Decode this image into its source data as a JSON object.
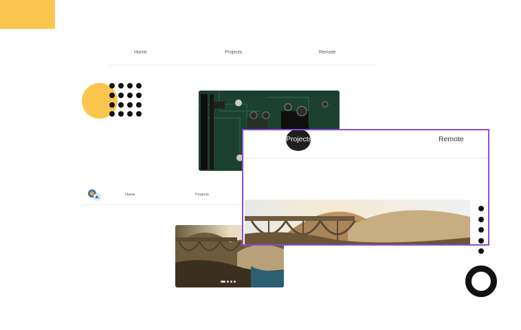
{
  "nav_back": {
    "home": "Home",
    "projects": "Projects",
    "remote": "Remote"
  },
  "nav_mid": {
    "home": "Home",
    "projects": "Projects"
  },
  "nav_front": {
    "projects": "Projects",
    "remote": "Remote"
  },
  "colors": {
    "accent_yellow": "#fcc54e",
    "highlight_border": "#8a4bd9",
    "dark": "#111111"
  },
  "icons": {
    "logo": "logo-icon"
  }
}
